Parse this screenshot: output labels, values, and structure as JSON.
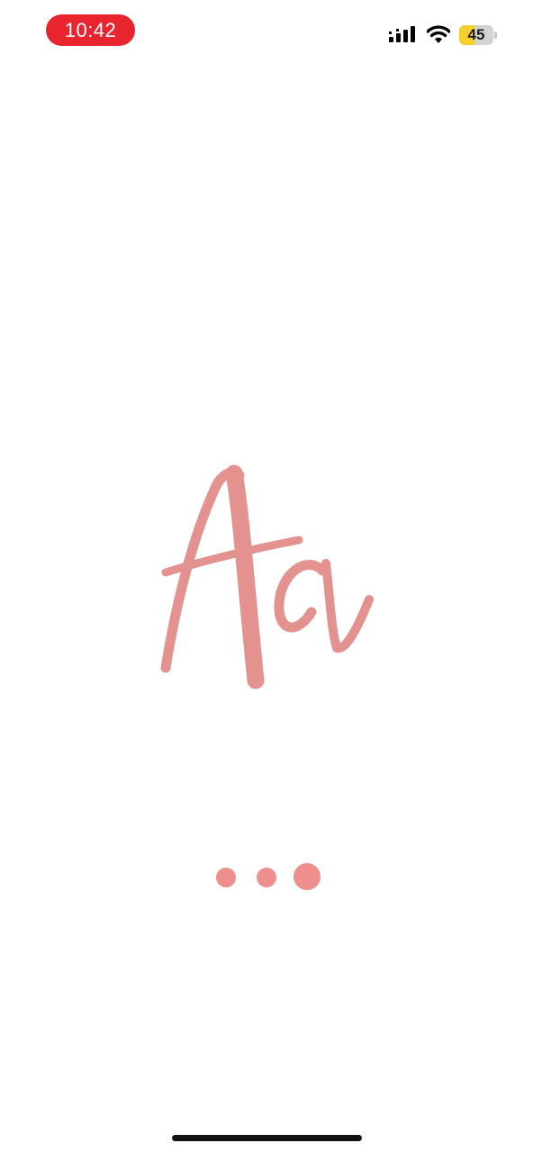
{
  "status_bar": {
    "time": "10:42",
    "battery_level": "45",
    "battery_fraction": 0.45,
    "time_pill_color": "#e8242f",
    "battery_color": "#f5cf2c",
    "icons": [
      "signal-icon",
      "wifi-icon",
      "battery-icon"
    ]
  },
  "splash": {
    "logo_text": "Aa",
    "logo_color": "#e39290",
    "loading_dots": 3,
    "dot_color": "#ee8f8e"
  }
}
